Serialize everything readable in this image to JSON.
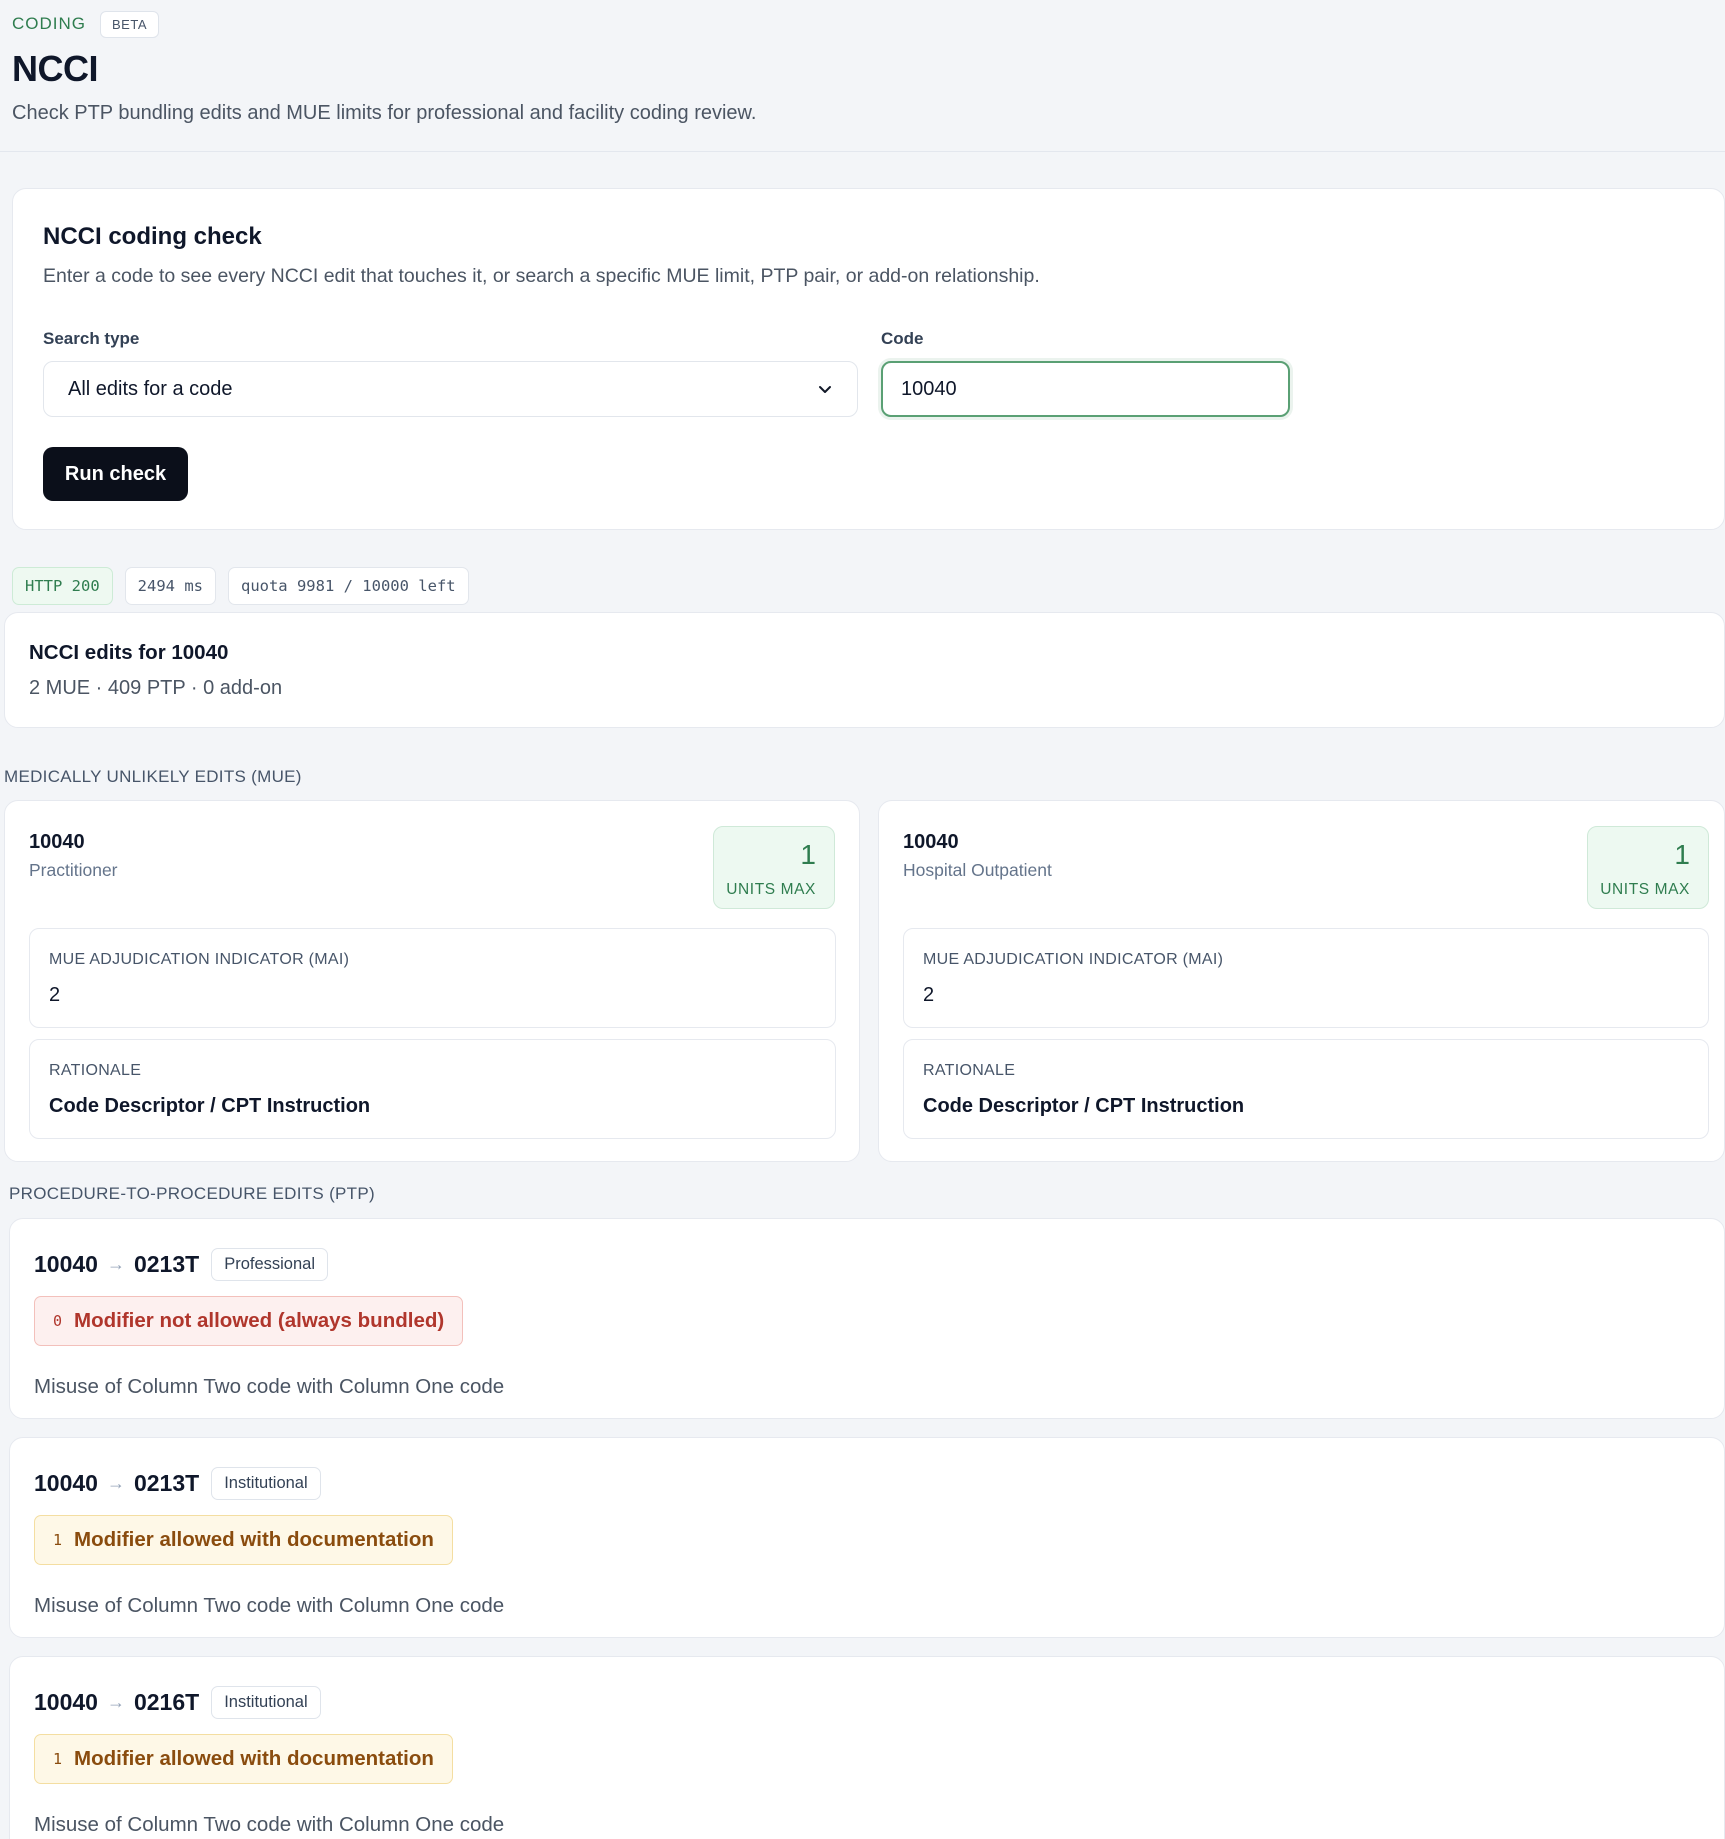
{
  "header": {
    "eyebrow": "CODING",
    "badge": "BETA",
    "title": "NCCI",
    "subtitle": "Check PTP bundling edits and MUE limits for professional and facility coding review."
  },
  "form": {
    "title": "NCCI coding check",
    "description": "Enter a code to see every NCCI edit that touches it, or search a specific MUE limit, PTP pair, or add-on relationship.",
    "search_type_label": "Search type",
    "search_type_value": "All edits for a code",
    "code_label": "Code",
    "code_value": "10040",
    "submit_label": "Run check"
  },
  "status": {
    "http": "HTTP 200",
    "latency": "2494 ms",
    "quota": "quota 9981 / 10000 left"
  },
  "summary": {
    "title": "NCCI edits for 10040",
    "counts": "2 MUE · 409 PTP · 0 add-on"
  },
  "mue": {
    "section_label": "MEDICALLY UNLIKELY EDITS (MUE)",
    "cards": [
      {
        "code": "10040",
        "setting": "Practitioner",
        "units": "1",
        "units_label": "UNITS MAX",
        "mai_label": "MUE ADJUDICATION INDICATOR (MAI)",
        "mai_value": "2",
        "rationale_label": "RATIONALE",
        "rationale_value": "Code Descriptor / CPT Instruction"
      },
      {
        "code": "10040",
        "setting": "Hospital Outpatient",
        "units": "1",
        "units_label": "UNITS MAX",
        "mai_label": "MUE ADJUDICATION INDICATOR (MAI)",
        "mai_value": "2",
        "rationale_label": "RATIONALE",
        "rationale_value": "Code Descriptor / CPT Instruction"
      }
    ]
  },
  "ptp": {
    "section_label": "PROCEDURE-TO-PROCEDURE EDITS (PTP)",
    "arrow": "→",
    "edits": [
      {
        "col1": "10040",
        "col2": "0213T",
        "type": "Professional",
        "modifier_code": "0",
        "modifier_text": "Modifier not allowed (always bundled)",
        "rationale": "Misuse of Column Two code with Column One code"
      },
      {
        "col1": "10040",
        "col2": "0213T",
        "type": "Institutional",
        "modifier_code": "1",
        "modifier_text": "Modifier allowed with documentation",
        "rationale": "Misuse of Column Two code with Column One code"
      },
      {
        "col1": "10040",
        "col2": "0216T",
        "type": "Institutional",
        "modifier_code": "1",
        "modifier_text": "Modifier allowed with documentation",
        "rationale": "Misuse of Column Two code with Column One code"
      }
    ]
  },
  "colors": {
    "accent_green": "#2f7d4f",
    "button_dark": "#0b0f1a",
    "error_red": "#b0362c",
    "warning_amber": "#8a4c0e"
  }
}
